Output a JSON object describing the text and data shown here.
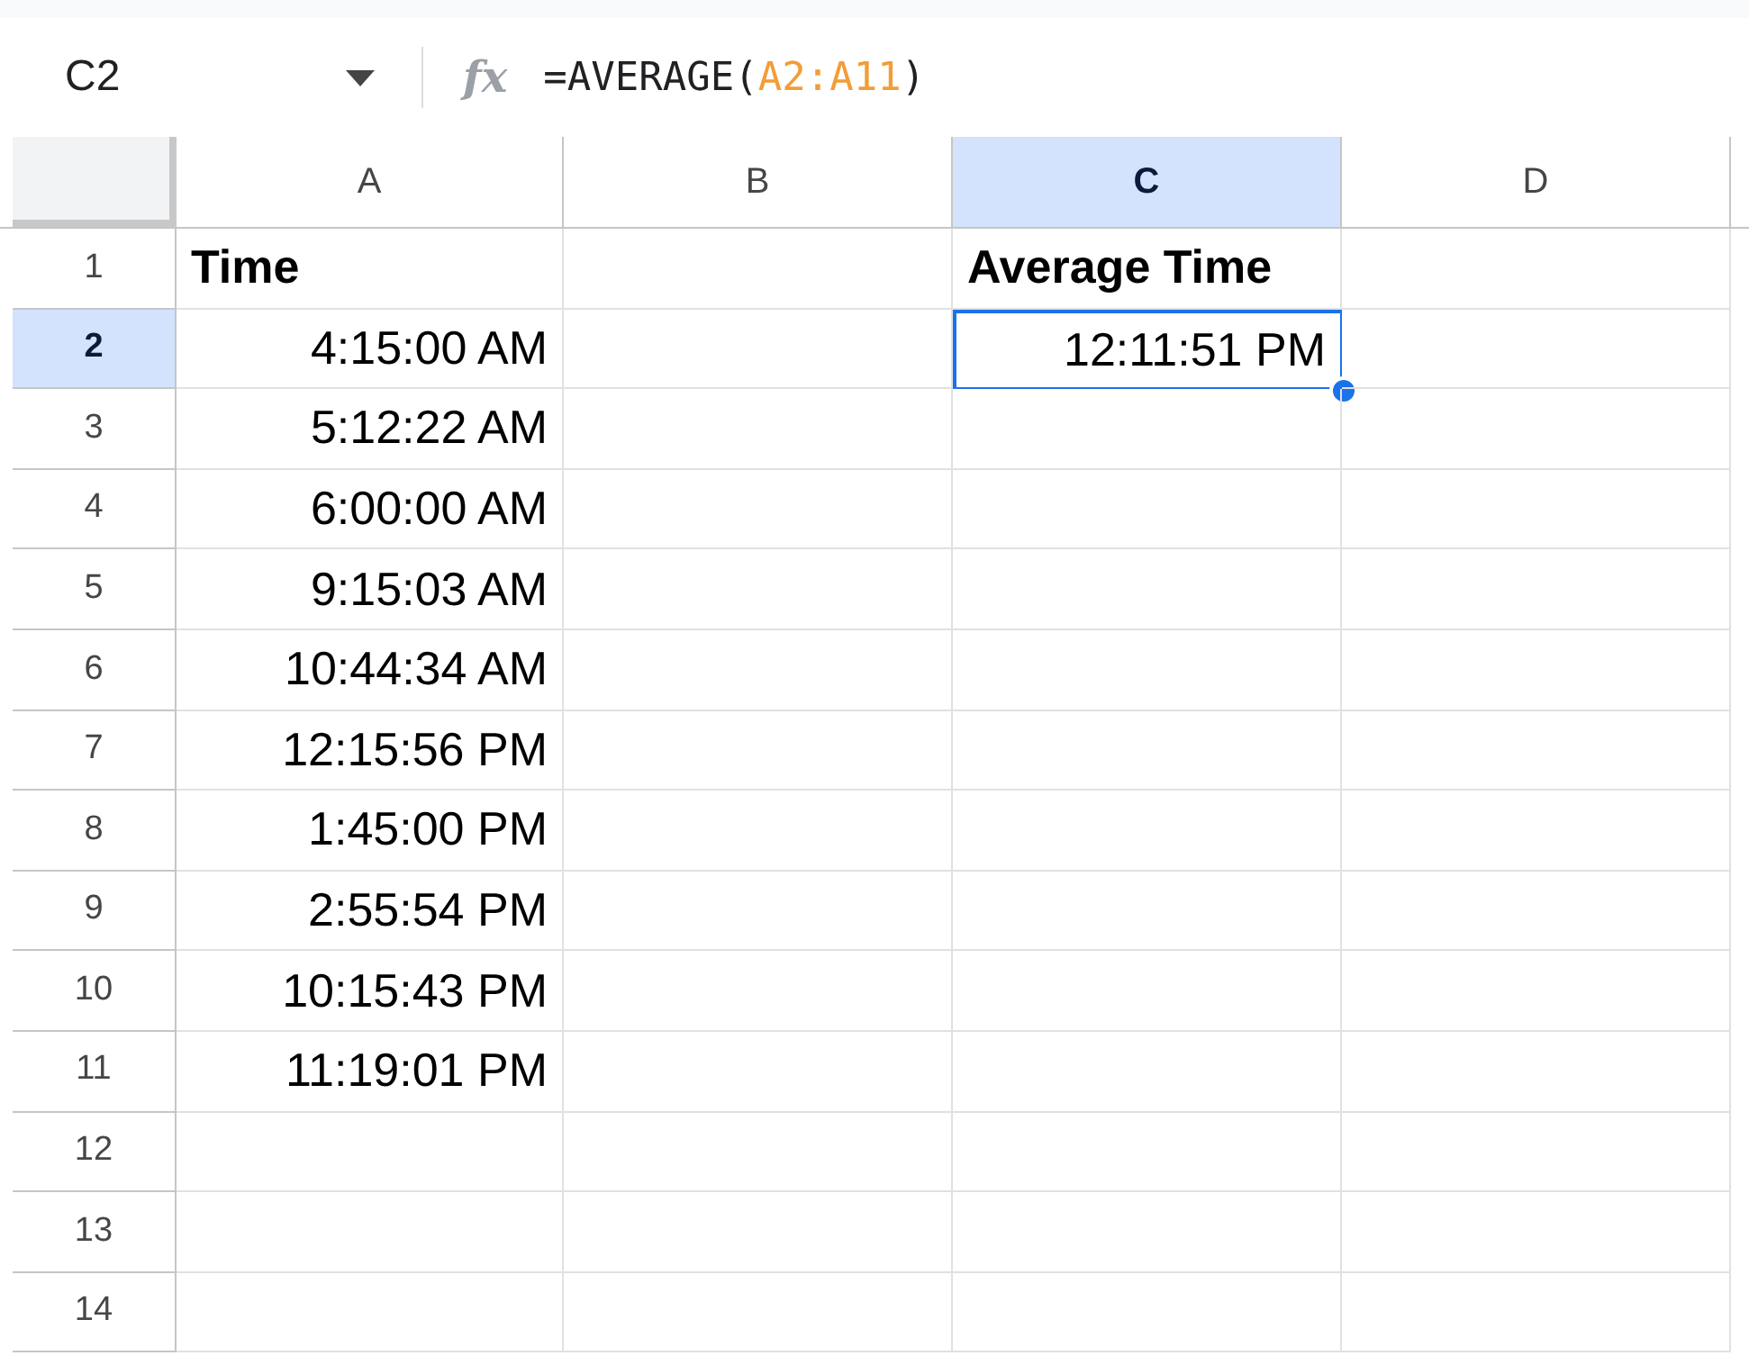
{
  "name_box": {
    "value": "C2"
  },
  "formula_bar": {
    "icon_text": "fx",
    "parts": [
      {
        "text": "=AVERAGE(",
        "kind": "plain"
      },
      {
        "text": "A2:A11",
        "kind": "range"
      },
      {
        "text": ")",
        "kind": "plain"
      }
    ]
  },
  "columns": [
    {
      "label": "A",
      "selected": false
    },
    {
      "label": "B",
      "selected": false
    },
    {
      "label": "C",
      "selected": true
    },
    {
      "label": "D",
      "selected": false
    }
  ],
  "rows": [
    {
      "label": "1",
      "selected": false,
      "cells": [
        {
          "text": "Time",
          "kind": "header",
          "selected": false
        },
        {
          "selected": false
        },
        {
          "text": "Average Time",
          "kind": "header",
          "selected": false
        },
        {
          "selected": false
        }
      ]
    },
    {
      "label": "2",
      "selected": true,
      "cells": [
        {
          "text": "4:15:00 AM",
          "kind": "time",
          "selected": false
        },
        {
          "selected": false
        },
        {
          "text": "12:11:51 PM",
          "kind": "time",
          "selected": true
        },
        {
          "selected": false
        }
      ]
    },
    {
      "label": "3",
      "selected": false,
      "cells": [
        {
          "text": "5:12:22 AM",
          "kind": "time",
          "selected": false
        },
        {
          "selected": false
        },
        {
          "selected": false
        },
        {
          "selected": false
        }
      ]
    },
    {
      "label": "4",
      "selected": false,
      "cells": [
        {
          "text": "6:00:00 AM",
          "kind": "time",
          "selected": false
        },
        {
          "selected": false
        },
        {
          "selected": false
        },
        {
          "selected": false
        }
      ]
    },
    {
      "label": "5",
      "selected": false,
      "cells": [
        {
          "text": "9:15:03 AM",
          "kind": "time",
          "selected": false
        },
        {
          "selected": false
        },
        {
          "selected": false
        },
        {
          "selected": false
        }
      ]
    },
    {
      "label": "6",
      "selected": false,
      "cells": [
        {
          "text": "10:44:34 AM",
          "kind": "time",
          "selected": false
        },
        {
          "selected": false
        },
        {
          "selected": false
        },
        {
          "selected": false
        }
      ]
    },
    {
      "label": "7",
      "selected": false,
      "cells": [
        {
          "text": "12:15:56 PM",
          "kind": "time",
          "selected": false
        },
        {
          "selected": false
        },
        {
          "selected": false
        },
        {
          "selected": false
        }
      ]
    },
    {
      "label": "8",
      "selected": false,
      "cells": [
        {
          "text": "1:45:00 PM",
          "kind": "time",
          "selected": false
        },
        {
          "selected": false
        },
        {
          "selected": false
        },
        {
          "selected": false
        }
      ]
    },
    {
      "label": "9",
      "selected": false,
      "cells": [
        {
          "text": "2:55:54 PM",
          "kind": "time",
          "selected": false
        },
        {
          "selected": false
        },
        {
          "selected": false
        },
        {
          "selected": false
        }
      ]
    },
    {
      "label": "10",
      "selected": false,
      "cells": [
        {
          "text": "10:15:43 PM",
          "kind": "time",
          "selected": false
        },
        {
          "selected": false
        },
        {
          "selected": false
        },
        {
          "selected": false
        }
      ]
    },
    {
      "label": "11",
      "selected": false,
      "cells": [
        {
          "text": "11:19:01 PM",
          "kind": "time",
          "selected": false
        },
        {
          "selected": false
        },
        {
          "selected": false
        },
        {
          "selected": false
        }
      ]
    },
    {
      "label": "12",
      "selected": false,
      "cells": [
        {
          "selected": false
        },
        {
          "selected": false
        },
        {
          "selected": false
        },
        {
          "selected": false
        }
      ]
    },
    {
      "label": "13",
      "selected": false,
      "cells": [
        {
          "selected": false
        },
        {
          "selected": false
        },
        {
          "selected": false
        },
        {
          "selected": false
        }
      ]
    },
    {
      "label": "14",
      "selected": false,
      "cells": [
        {
          "selected": false
        },
        {
          "selected": false
        },
        {
          "selected": false
        },
        {
          "selected": false
        }
      ]
    }
  ]
}
